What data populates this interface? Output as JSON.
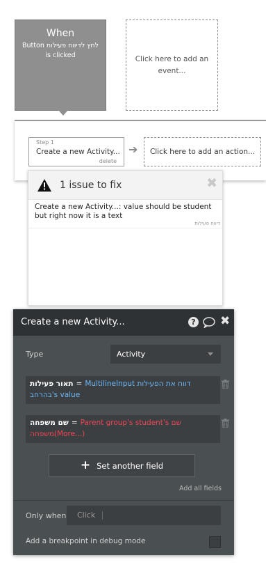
{
  "workflow": {
    "event": {
      "title": "When",
      "description": "לחץ לדיווח פעילות Button is clicked"
    },
    "add_event_label": "Click here to add an event..."
  },
  "actions": {
    "step_label": "Step 1",
    "step_title": "Create a new Activity...",
    "delete_label": "delete",
    "add_action_label": "Click here to add an action..."
  },
  "issues": {
    "title": "1 issue to fix",
    "items": [
      {
        "text": "Create a new Activity...: value should be student but right now it is a text",
        "source": "דיווח פעילות"
      }
    ]
  },
  "editor": {
    "title": "Create a new Activity...",
    "help_symbol": "?",
    "close_symbol": "✖",
    "type_label": "Type",
    "type_value": "Activity",
    "fields": [
      {
        "name": "תאור פעילות",
        "equals": "=",
        "value": "MultilineInput דווח את הפעילות בהרחב's value",
        "status": "ok"
      },
      {
        "name": "שם משפחה",
        "equals": "=",
        "value": "Parent group's student's שם משפחה(More...)",
        "status": "error"
      }
    ],
    "set_field_label": "Set another field",
    "add_all_label": "Add all fields",
    "only_when_label": "Only when",
    "only_when_placeholder": "Click",
    "breakpoint_label": "Add a breakpoint in debug mode"
  },
  "colors": {
    "event_gray": "#8f8f8f",
    "editor_bg": "#4a4f52",
    "editor_header": "#2e3235",
    "value_blue": "#6fb7f5",
    "value_error_red": "#ee4553"
  }
}
